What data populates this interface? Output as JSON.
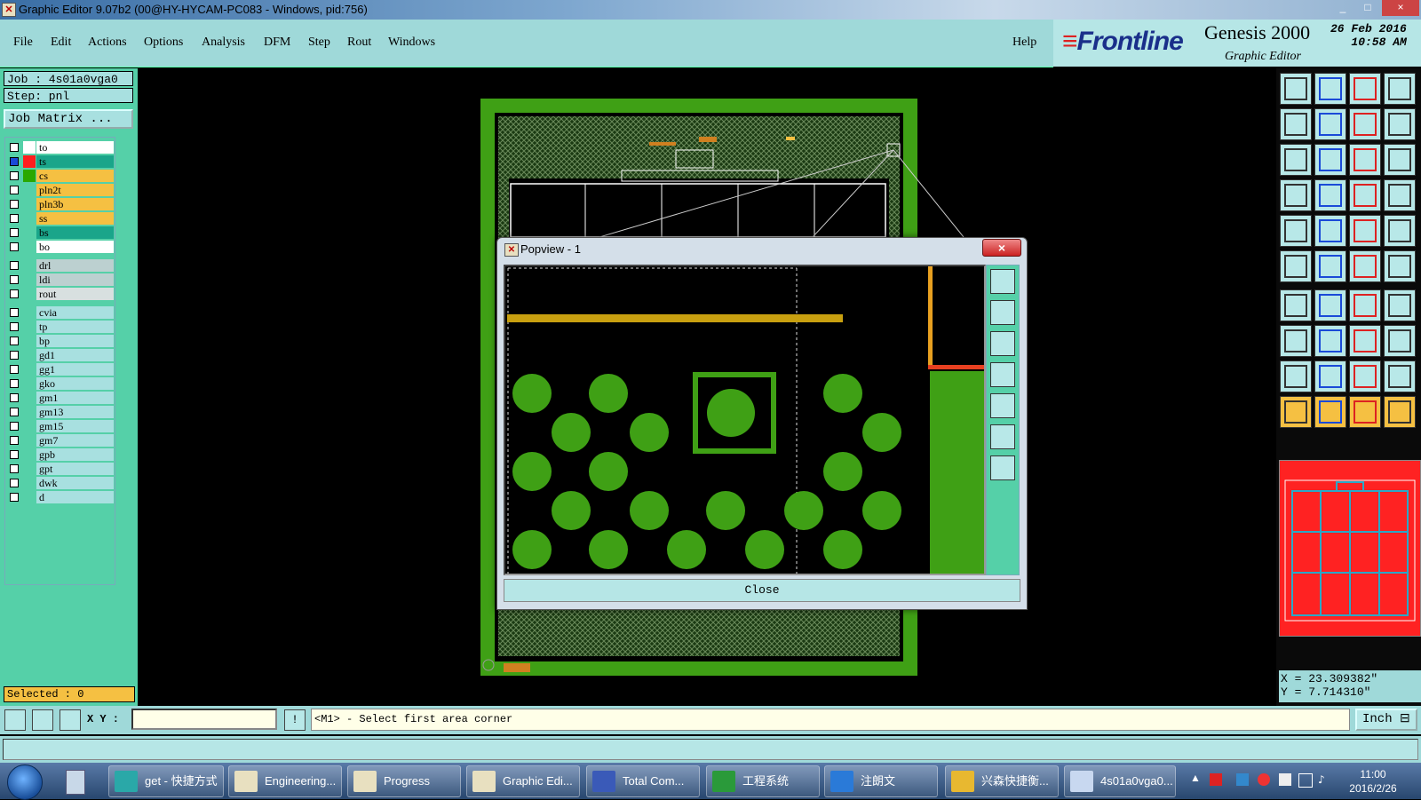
{
  "window": {
    "title": "Graphic Editor 9.07b2 (00@HY-HYCAM-PC083 - Windows, pid:756)",
    "minimize": "_",
    "maximize": "□",
    "close": "×"
  },
  "menu": {
    "items": [
      "File",
      "Edit",
      "Actions",
      "Options",
      "Analysis",
      "DFM",
      "Step",
      "Rout",
      "Windows"
    ],
    "help": "Help"
  },
  "brand": {
    "logo": "Frontline",
    "product": "Genesis 2000",
    "subtitle": "Graphic Editor",
    "date": "26 Feb 2016",
    "time": "10:58 AM"
  },
  "job": {
    "job_label": "Job : 4s01a0vga0",
    "step_label": "Step: pnl",
    "matrix_button": "Job Matrix ..."
  },
  "layers": [
    {
      "name": "to",
      "color": "#ffffff",
      "swatch": "#ffffff"
    },
    {
      "name": "ts",
      "color": "#1aa58a",
      "swatch": "#ff1e1e",
      "active": true
    },
    {
      "name": "cs",
      "color": "#f5c042",
      "swatch": "#2aa800"
    },
    {
      "name": "pln2t",
      "color": "#f5c042",
      "swatch": ""
    },
    {
      "name": "pln3b",
      "color": "#f5c042",
      "swatch": ""
    },
    {
      "name": "ss",
      "color": "#f5c042",
      "swatch": ""
    },
    {
      "name": "bs",
      "color": "#1aa58a",
      "swatch": ""
    },
    {
      "name": "bo",
      "color": "#ffffff",
      "swatch": ""
    },
    {
      "name": "drl",
      "color": "#bcd0d0",
      "swatch": ""
    },
    {
      "name": "ldi",
      "color": "#bcd0d0",
      "swatch": ""
    },
    {
      "name": "rout",
      "color": "#d8e0e0",
      "swatch": ""
    },
    {
      "name": "cvia",
      "color": "#a8e0e0",
      "swatch": ""
    },
    {
      "name": "tp",
      "color": "#a8e0e0",
      "swatch": ""
    },
    {
      "name": "bp",
      "color": "#a8e0e0",
      "swatch": ""
    },
    {
      "name": "gd1",
      "color": "#a8e0e0",
      "swatch": ""
    },
    {
      "name": "gg1",
      "color": "#a8e0e0",
      "swatch": ""
    },
    {
      "name": "gko",
      "color": "#a8e0e0",
      "swatch": ""
    },
    {
      "name": "gm1",
      "color": "#a8e0e0",
      "swatch": ""
    },
    {
      "name": "gm13",
      "color": "#a8e0e0",
      "swatch": ""
    },
    {
      "name": "gm15",
      "color": "#a8e0e0",
      "swatch": ""
    },
    {
      "name": "gm7",
      "color": "#a8e0e0",
      "swatch": ""
    },
    {
      "name": "gpb",
      "color": "#a8e0e0",
      "swatch": ""
    },
    {
      "name": "gpt",
      "color": "#a8e0e0",
      "swatch": ""
    },
    {
      "name": "dwk",
      "color": "#a8e0e0",
      "swatch": ""
    },
    {
      "name": "d",
      "color": "#a8e0e0",
      "swatch": ""
    }
  ],
  "selected": "Selected : 0",
  "popview": {
    "title": "Popview - 1",
    "close_x": "×",
    "close_button": "Close"
  },
  "coords": {
    "x": "X = 23.309382\"",
    "y": "Y = 7.714310\""
  },
  "status": {
    "xy_label": "X Y :",
    "xy_value": "",
    "info_icon": "!",
    "prompt": "<M1> - Select first area corner",
    "unit": "Inch"
  },
  "taskbar": {
    "items": [
      {
        "label": "get - 快捷方式",
        "icon_color": "#2aa8a8"
      },
      {
        "label": "Engineering...",
        "icon_color": "#e8e0c0"
      },
      {
        "label": "Progress",
        "icon_color": "#e8e0c0"
      },
      {
        "label": "Graphic Edi...",
        "icon_color": "#e8e0c0"
      },
      {
        "label": "Total Com...",
        "icon_color": "#3a5ab8"
      },
      {
        "label": "工程系统",
        "icon_color": "#2a9a3a"
      },
      {
        "label": "注朗文",
        "icon_color": "#2a7ad8"
      },
      {
        "label": "兴森快捷衡...",
        "icon_color": "#e8b830"
      },
      {
        "label": "4s01a0vga0...",
        "icon_color": "#c8d8f0"
      }
    ],
    "clock_time": "11:00",
    "clock_date": "2016/2/26"
  }
}
